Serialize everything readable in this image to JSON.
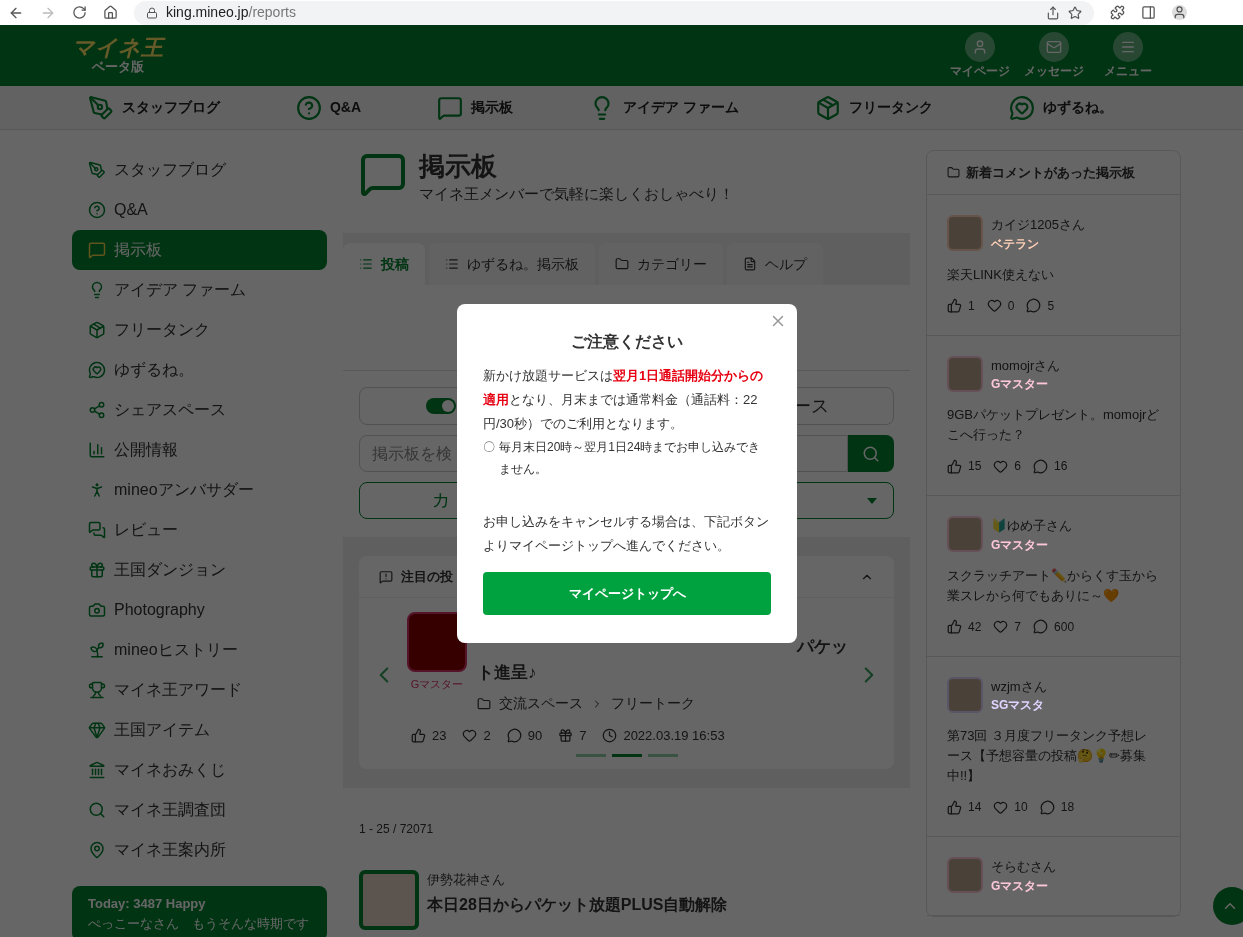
{
  "browser": {
    "url_host": "king.mineo.jp",
    "url_path": "/reports"
  },
  "header": {
    "logo": "マイネ王",
    "logo_sub": "ベータ版",
    "actions": [
      "マイページ",
      "メッセージ",
      "メニュー"
    ]
  },
  "nav": [
    "スタッフブログ",
    "Q&A",
    "掲示板",
    "アイデア ファーム",
    "フリータンク",
    "ゆずるね。"
  ],
  "sidebar": {
    "items": [
      {
        "label": "スタッフブログ",
        "selected": false
      },
      {
        "label": "Q&A",
        "selected": false
      },
      {
        "label": "掲示板",
        "selected": true
      },
      {
        "label": "アイデア ファーム",
        "selected": false
      },
      {
        "label": "フリータンク",
        "selected": false
      },
      {
        "label": "ゆずるね。",
        "selected": false
      },
      {
        "label": "シェアスペース",
        "selected": false
      },
      {
        "label": "公開情報",
        "selected": false
      },
      {
        "label": "mineoアンバサダー",
        "selected": false
      },
      {
        "label": "レビュー",
        "selected": false
      },
      {
        "label": "王国ダンジョン",
        "selected": false
      },
      {
        "label": "Photography",
        "selected": false
      },
      {
        "label": "mineoヒストリー",
        "selected": false
      },
      {
        "label": "マイネ王アワード",
        "selected": false
      },
      {
        "label": "王国アイテム",
        "selected": false
      },
      {
        "label": "マイネおみくじ",
        "selected": false
      },
      {
        "label": "マイネ王調査団",
        "selected": false
      },
      {
        "label": "マイネ王案内所",
        "selected": false
      }
    ],
    "today": {
      "title": "Today: 3487 Happy",
      "text": "ぺっこーなさん　もうそんな時期です"
    }
  },
  "board": {
    "title": "掲示板",
    "subtitle": "マイネ王メンバーで気軽に楽しくおしゃべり！",
    "tabs": [
      {
        "label": "投稿",
        "selected": true
      },
      {
        "label": "ゆずるね。掲示板",
        "selected": false
      },
      {
        "label": "カテゴリー",
        "selected": false
      },
      {
        "label": "ヘルプ",
        "selected": false
      }
    ],
    "toggle": {
      "on": true,
      "label_fragment": "ース"
    },
    "search": {
      "placeholder": "掲示板を検"
    },
    "category_select": {
      "value_fragment": "カ"
    },
    "featured": {
      "heading": "注目の投",
      "rank": "Gマスター",
      "title_fragment_1": "パケッ",
      "title_fragment_2": "ト進呈♪",
      "category": "交流スペース",
      "subcategory": "フリートーク",
      "likes": "23",
      "hearts": "2",
      "comments": "90",
      "gifts": "7",
      "datetime": "2022.03.19 16:53",
      "dots": [
        {
          "selected": false
        },
        {
          "selected": true
        },
        {
          "selected": false
        }
      ]
    },
    "count": "1 - 25 / 72071",
    "post": {
      "author": "伊勢花神さん",
      "title": "本日28日からパケット放題PLUS自動解除"
    }
  },
  "recent": {
    "heading": "新着コメントがあった掲示板",
    "items": [
      {
        "name": "カイジ1205さん",
        "rank": "ベテラン",
        "color": "#ffd0b8",
        "text": "楽天LINK使えない",
        "likes": "1",
        "hearts": "0",
        "comments": "5"
      },
      {
        "name": "momojrさん",
        "rank": "Gマスター",
        "color": "#ffc8da",
        "text": "9GBパケットプレゼント。momojrどこへ行った？",
        "likes": "15",
        "hearts": "6",
        "comments": "16"
      },
      {
        "name": "🔰ゆめ子さん",
        "rank": "Gマスター",
        "color": "#ffc8da",
        "text": "スクラッチアート✏️からくす玉から業スレから何でもありに～🧡",
        "likes": "42",
        "hearts": "7",
        "comments": "600"
      },
      {
        "name": "wzjmさん",
        "rank": "SGマスタ",
        "color": "#e2d4ff",
        "text": "第73回 ３月度フリータンク予想レース【予想容量の投稿🤔💡✏募集中!!】",
        "likes": "14",
        "hearts": "10",
        "comments": "18"
      },
      {
        "name": "そらむさん",
        "rank": "Gマスター",
        "color": "#ffc8da"
      }
    ]
  },
  "modal": {
    "title": "ご注意ください",
    "body": "新かけ放題サービスは**翌月1日通話開始分からの適用**となり、月末までは通常料金（通話料：22円/30秒）でのご利用となります。",
    "note_mark": "〇",
    "note": "毎月末日20時～翌月1日24時までお申し込みできません。",
    "body2": "お申し込みをキャンセルする場合は、下記ボタンよりマイページトップへ進んでください。",
    "button": "マイページトップへ"
  }
}
